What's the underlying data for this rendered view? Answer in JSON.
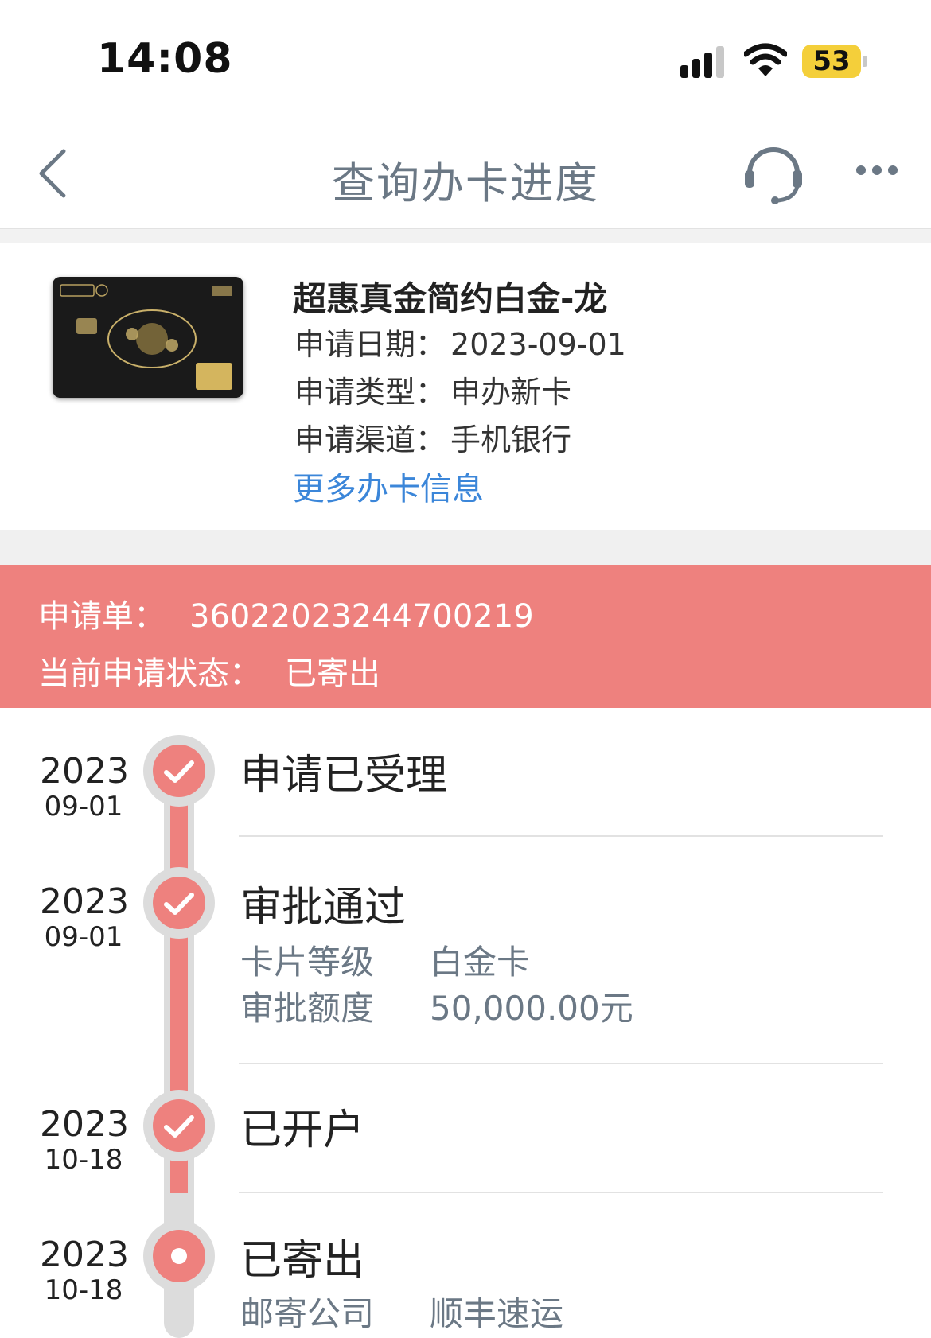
{
  "status_bar": {
    "time": "14:08",
    "battery": "53"
  },
  "nav": {
    "title": "查询办卡进度"
  },
  "card": {
    "name": "超惠真金简约白金-龙",
    "apply_date_label": "申请日期：",
    "apply_date": "2023-09-01",
    "apply_type_label": "申请类型：",
    "apply_type": "申办新卡",
    "apply_channel_label": "申请渠道：",
    "apply_channel": "手机银行",
    "more_info_link": "更多办卡信息"
  },
  "application": {
    "number_label": "申请单：",
    "number": "3602202324470021​9",
    "status_label": "当前申请状态：",
    "status": "已寄出"
  },
  "timeline": [
    {
      "year": "2023",
      "date": "09-01",
      "title": "申请已受理",
      "state": "done"
    },
    {
      "year": "2023",
      "date": "09-01",
      "title": "审批通过",
      "state": "done",
      "details": [
        {
          "label": "卡片等级",
          "value": "白金卡"
        },
        {
          "label": "审批额度",
          "value": "50,000.00元"
        }
      ]
    },
    {
      "year": "2023",
      "date": "10-18",
      "title": "已开户",
      "state": "done"
    },
    {
      "year": "2023",
      "date": "10-18",
      "title": "已寄出",
      "state": "current",
      "details": [
        {
          "label": "邮寄公司",
          "value": "顺丰速运"
        }
      ]
    }
  ],
  "colors": {
    "accent": "#ee817e",
    "link": "#3b86d9",
    "muted": "#6b7885",
    "track": "#dcdcdc"
  },
  "icons": [
    "back-icon",
    "customer-service-icon",
    "more-icon",
    "check-icon",
    "signal-icon",
    "wifi-icon",
    "battery-icon"
  ]
}
